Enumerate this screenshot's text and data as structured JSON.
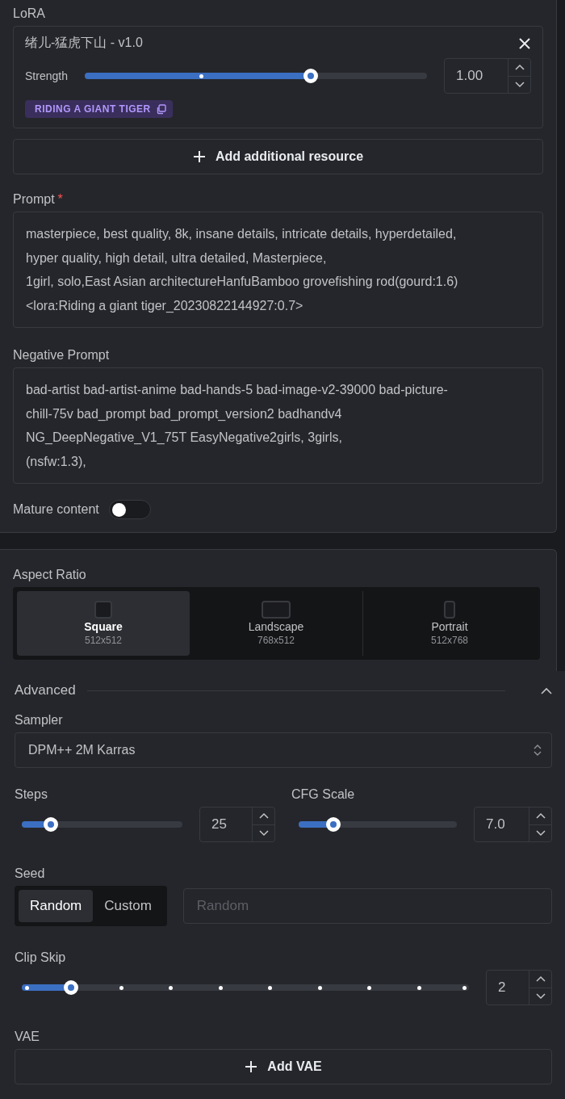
{
  "lora": {
    "label": "LoRA",
    "resource": {
      "name": "绪儿-猛虎下山 - v1.0",
      "strength_label": "Strength",
      "level": 0.66,
      "value": "1.00",
      "trigger": "RIDING A GIANT TIGER"
    },
    "add_button": "Add additional resource"
  },
  "prompt": {
    "label": "Prompt",
    "required_mark": "*",
    "lines": [
      "masterpiece, best quality, 8k, insane details, intricate details, hyperdetailed,",
      "hyper quality, high detail, ultra detailed, Masterpiece,",
      "1girl, solo,East Asian architectureHanfuBamboo grovefishing rod(gourd:1.6)",
      "<lora:Riding a giant tiger_20230822144927:0.7>"
    ]
  },
  "negative_prompt": {
    "label": "Negative Prompt",
    "lines": [
      "bad-artist bad-artist-anime bad-hands-5 bad-image-v2-39000 bad-picture-",
      "chill-75v bad_prompt bad_prompt_version2 badhandv4",
      "NG_DeepNegative_V1_75T EasyNegative2girls, 3girls,",
      "(nsfw:1.3),"
    ]
  },
  "mature_content": {
    "label": "Mature content",
    "on": false
  },
  "aspect_ratio": {
    "label": "Aspect Ratio",
    "options": [
      {
        "kind": "square",
        "label": "Square",
        "size": "512x512",
        "selected": true
      },
      {
        "kind": "landscape",
        "label": "Landscape",
        "size": "768x512",
        "selected": false
      },
      {
        "kind": "portrait",
        "label": "Portrait",
        "size": "512x768",
        "selected": false
      }
    ]
  },
  "advanced": {
    "label": "Advanced",
    "expanded": true,
    "sampler": {
      "label": "Sampler",
      "value": "DPM++ 2M Karras"
    },
    "steps": {
      "label": "Steps",
      "level": 0.18,
      "value": "25"
    },
    "cfg_scale": {
      "label": "CFG Scale",
      "level": 0.22,
      "value": "7.0"
    },
    "seed": {
      "label": "Seed",
      "modes": [
        {
          "label": "Random",
          "selected": true
        },
        {
          "label": "Custom",
          "selected": false
        }
      ],
      "placeholder": "Random"
    },
    "clip_skip": {
      "label": "Clip Skip",
      "level": 0.111,
      "value": "2"
    },
    "vae": {
      "label": "VAE",
      "button": "Add VAE"
    }
  }
}
